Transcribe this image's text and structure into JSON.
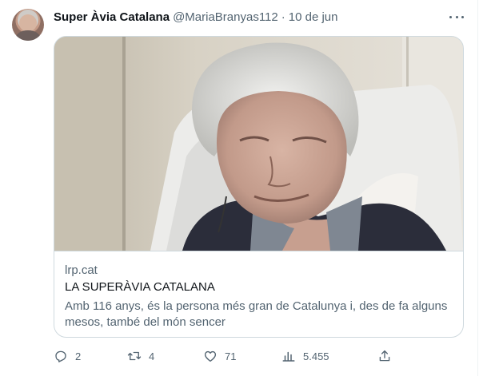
{
  "tweet": {
    "display_name": "Super Àvia Catalana",
    "handle": "@MariaBranyas112",
    "separator": "·",
    "date": "10 de jun",
    "avatar_icon": "profile-avatar"
  },
  "card": {
    "image_icon": "elderly-woman-photo",
    "domain": "lrp.cat",
    "title": "LA SUPERÀVIA CATALANA",
    "description": "Amb 116 anys, és la persona més gran de Catalunya i, des de fa alguns mesos, també del món sencer"
  },
  "actions": {
    "replies": "2",
    "retweets": "4",
    "likes": "71",
    "views": "5.455"
  },
  "colors": {
    "text_primary": "#0f1419",
    "text_secondary": "#536471",
    "border": "#cfd9de"
  }
}
